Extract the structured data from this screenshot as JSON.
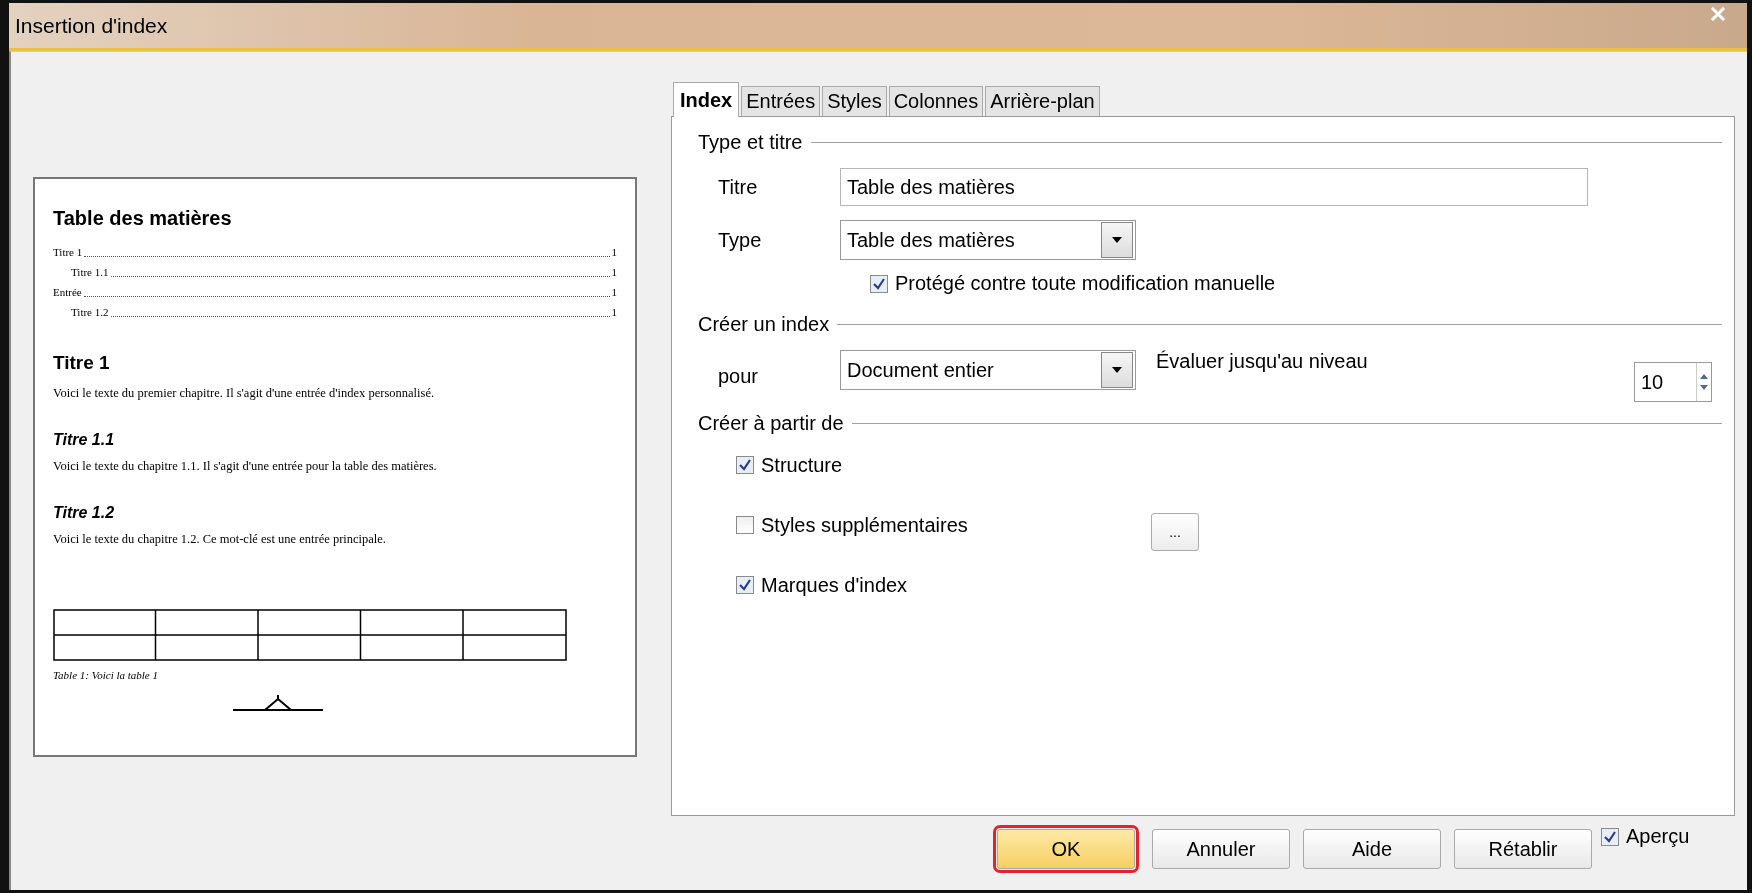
{
  "window": {
    "title": "Insertion d'index"
  },
  "preview": {
    "heading": "Table des matières",
    "toc": [
      {
        "label": "Titre 1",
        "page": "1",
        "children": [
          {
            "label": "Titre 1.1",
            "page": "1"
          }
        ]
      },
      {
        "label": "Entrée",
        "page": "1",
        "children": [
          {
            "label": "Titre 1.2",
            "page": "1"
          }
        ]
      }
    ],
    "sections": [
      {
        "kind": "h1",
        "title": "Titre 1",
        "text": "Voici le texte du premier chapitre. Il s'agit d'une entrée d'index personnalisé."
      },
      {
        "kind": "h2",
        "title": "Titre 1.1",
        "text": "Voici le texte du chapitre 1.1. Il s'agit d'une entrée pour la table des matières."
      },
      {
        "kind": "h2",
        "title": "Titre 1.2",
        "text": "Voici le texte du chapitre 1.2. Ce mot-clé est une entrée principale."
      }
    ],
    "caption": "Table 1: Voici la table 1"
  },
  "tabs": [
    {
      "label": "Index",
      "selected": true
    },
    {
      "label": "Entrées",
      "selected": false
    },
    {
      "label": "Styles",
      "selected": false
    },
    {
      "label": "Colonnes",
      "selected": false
    },
    {
      "label": "Arrière-plan",
      "selected": false
    }
  ],
  "type_et_titre": {
    "heading": "Type et titre",
    "title_label": "Titre",
    "title_value": "Table des matières",
    "type_label": "Type",
    "type_value": "Table des matières",
    "protected": {
      "label": "Protégé contre toute modification manuelle",
      "checked": true
    }
  },
  "creer_index": {
    "heading": "Créer un index",
    "for_label": "pour",
    "for_value": "Document entier",
    "level_label": "Évaluer jusqu'au niveau",
    "level_value": "10"
  },
  "creer_a_partir": {
    "heading": "Créer à partir de",
    "options": [
      {
        "label": "Structure",
        "checked": true,
        "more": false
      },
      {
        "label": "Styles supplémentaires",
        "checked": false,
        "more": true,
        "more_label": "..."
      },
      {
        "label": "Marques d'index",
        "checked": true,
        "more": false
      }
    ]
  },
  "buttons": [
    {
      "label": "OK",
      "highlighted": true
    },
    {
      "label": "Annuler",
      "highlighted": false
    },
    {
      "label": "Aide",
      "highlighted": false
    },
    {
      "label": "Rétablir",
      "highlighted": false
    }
  ],
  "preview_toggle": {
    "label": "Aperçu",
    "checked": true
  }
}
